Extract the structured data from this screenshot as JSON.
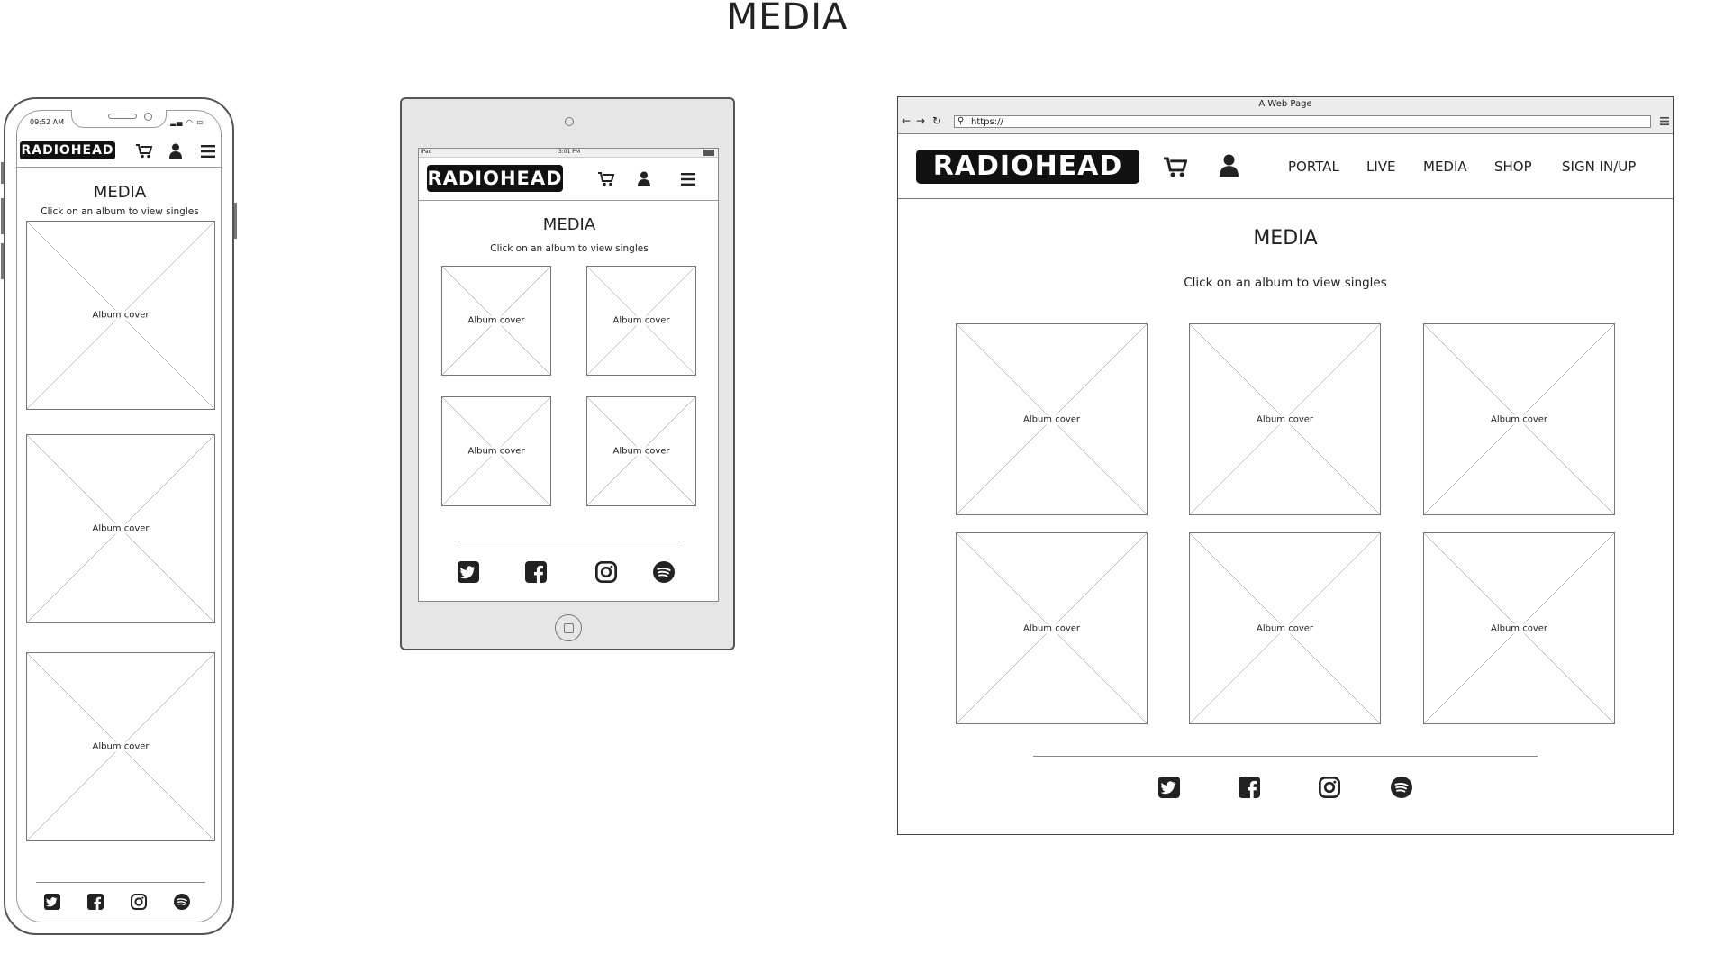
{
  "page_title": "MEDIA",
  "brand": "RADIOHEAD",
  "section_title": "MEDIA",
  "subtitle": "Click on an album to view singles",
  "album_label": "Album cover",
  "phone": {
    "time": "09:52 AM"
  },
  "tablet": {
    "carrier": "iPad",
    "time": "3:01 PM"
  },
  "browser": {
    "window_title": "A Web Page",
    "url": "https://",
    "nav": [
      "PORTAL",
      "LIVE",
      "MEDIA",
      "SHOP",
      "SIGN IN/UP"
    ]
  },
  "header_icons": [
    "cart-icon",
    "user-icon",
    "hamburger-menu-icon"
  ],
  "social_icons": [
    "twitter-icon",
    "facebook-icon",
    "instagram-icon",
    "spotify-icon"
  ]
}
